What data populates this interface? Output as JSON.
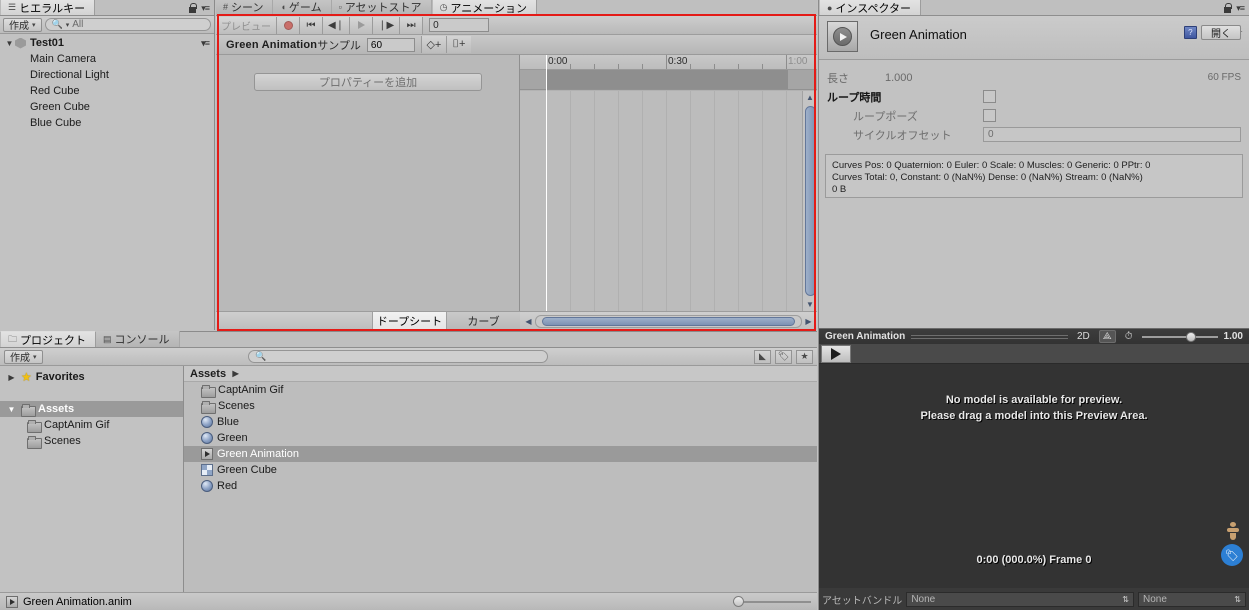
{
  "hierarchy": {
    "tab_label": "ヒエラルキー",
    "tab_icon": "hierarchy-icon",
    "create_label": "作成",
    "search_placeholder": "All",
    "root": "Test01",
    "items": [
      {
        "label": "Main Camera"
      },
      {
        "label": "Directional Light"
      },
      {
        "label": "Red Cube"
      },
      {
        "label": "Green Cube"
      },
      {
        "label": "Blue Cube"
      }
    ]
  },
  "center_tabs": [
    {
      "label": "シーン",
      "icon": "grid-icon",
      "active": false
    },
    {
      "label": "ゲーム",
      "icon": "gamepad-icon",
      "active": false
    },
    {
      "label": "アセットストア",
      "icon": "store-icon",
      "active": false
    },
    {
      "label": "アニメーション",
      "icon": "animation-icon",
      "active": true
    }
  ],
  "animation": {
    "preview_label": "プレビュー",
    "record_label": "record",
    "first_key_label": "⏮",
    "prev_key_label": "◀|",
    "play_label": "▶",
    "next_key_label": "|▶",
    "last_key_label": "⏭",
    "frame_value": "0",
    "clip_name": "Green Animation",
    "sample_label": "サンプル",
    "sample_value": "60",
    "add_keyframe_label": "◇+",
    "add_event_label": "⌷+",
    "add_property_label": "プロパティーを追加",
    "dope_sheet_label": "ドープシート",
    "curves_label": "カーブ",
    "ruler_labels": [
      "0:00",
      "0:30",
      "1:00"
    ]
  },
  "inspector": {
    "tab_label": "インスペクター",
    "title": "Green Animation",
    "open_label": "開く",
    "length_label": "長さ",
    "length_value": "1.000",
    "fps_label": "60 FPS",
    "loop_time_label": "ループ時間",
    "loop_pose_label": "ループポーズ",
    "cycle_offset_label": "サイクルオフセット",
    "cycle_offset_value": "0",
    "curves_info_line1": "Curves Pos: 0 Quaternion: 0 Euler: 0 Scale: 0 Muscles: 0 Generic: 0 PPtr: 0",
    "curves_info_line2": "Curves Total: 0, Constant: 0 (NaN%) Dense: 0 (NaN%) Stream: 0 (NaN%)",
    "curves_info_line3": "0 B"
  },
  "preview": {
    "title": "Green Animation",
    "mode_2d_label": "2D",
    "lighting_icon": "axis-icon",
    "audio_icon": "clock-icon",
    "zoom_value": "1.00",
    "message_line1": "No model is available for preview.",
    "message_line2": "Please drag a model into this Preview Area.",
    "frame_info": "0:00 (000.0%) Frame 0",
    "asset_bundle_label": "アセットバンドル",
    "asset_bundle_value": "None",
    "asset_variant_value": "None"
  },
  "project": {
    "tabs": [
      {
        "label": "プロジェクト",
        "icon": "folder-icon",
        "active": true
      },
      {
        "label": "コンソール",
        "icon": "console-icon",
        "active": false
      }
    ],
    "create_label": "作成",
    "search_placeholder": "",
    "tree": [
      {
        "label": "Favorites",
        "icon": "star-icon",
        "depth": 0,
        "arrow": "▶",
        "selected": false
      },
      {
        "label": "Assets",
        "icon": "folder-icon",
        "depth": 0,
        "arrow": "▼",
        "selected": true
      },
      {
        "label": "CaptAnim Gif",
        "icon": "folder-icon",
        "depth": 1,
        "arrow": "",
        "selected": false
      },
      {
        "label": "Scenes",
        "icon": "folder-icon",
        "depth": 1,
        "arrow": "",
        "selected": false
      }
    ],
    "breadcrumb": "Assets",
    "files": [
      {
        "label": "CaptAnim Gif",
        "icon": "folder-icon",
        "selected": false
      },
      {
        "label": "Scenes",
        "icon": "folder-icon",
        "selected": false
      },
      {
        "label": "Blue",
        "icon": "material-icon",
        "selected": false
      },
      {
        "label": "Green",
        "icon": "material-icon",
        "selected": false
      },
      {
        "label": "Green Animation",
        "icon": "animation-icon",
        "selected": true
      },
      {
        "label": "Green Cube",
        "icon": "prefab-icon",
        "selected": false
      },
      {
        "label": "Red",
        "icon": "material-icon",
        "selected": false
      }
    ],
    "status_file": "Green Animation.anim"
  }
}
